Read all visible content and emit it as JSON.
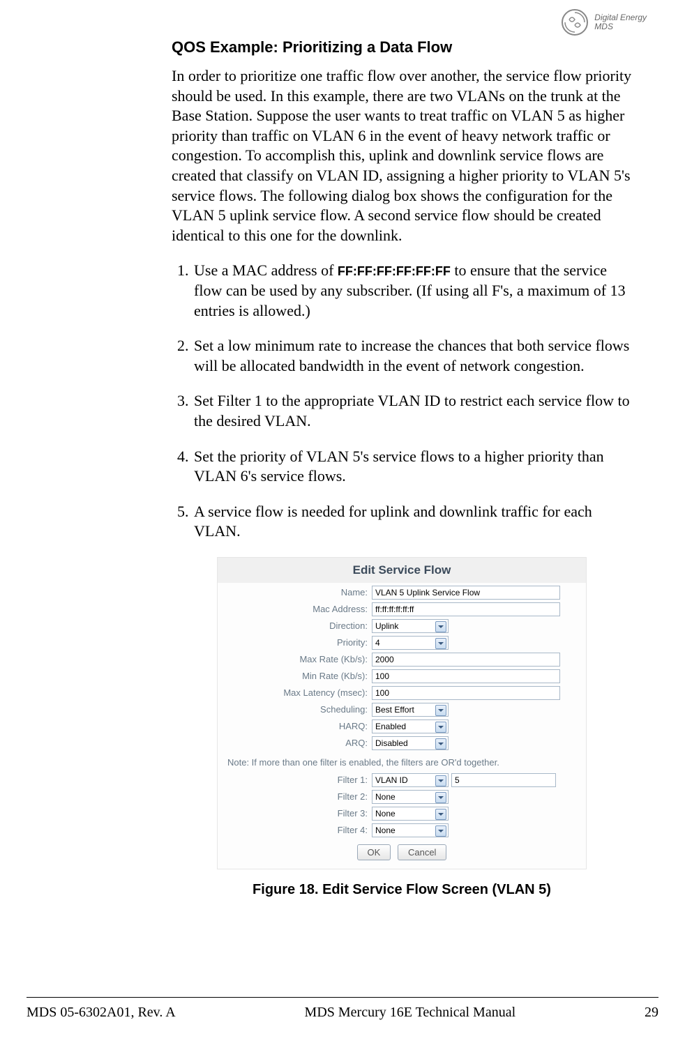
{
  "header": {
    "brand_line1": "Digital Energy",
    "brand_line2": "MDS"
  },
  "section": {
    "title": "QOS Example: Prioritizing a Data Flow",
    "intro": "In order to prioritize one traffic flow over another, the service flow priority should be used. In this example, there are two VLANs on the trunk at the Base Station. Suppose the user wants to treat traffic on VLAN 5 as higher priority than traffic on VLAN 6 in the event of heavy network traffic or congestion. To accomplish this, uplink and downlink service flows are created that classify on VLAN ID, assigning a higher priority to VLAN 5's service flows. The following dialog box shows the configuration for the VLAN 5 uplink service flow. A second service flow should be created identical to this one for the downlink.",
    "steps": [
      {
        "pre": "Use a MAC address of ",
        "code": "FF:FF:FF:FF:FF:FF",
        "post": " to ensure that the service flow can be used by any subscriber. (If using all F's, a maximum of 13 entries is allowed.)"
      },
      {
        "text": "Set a low minimum rate to increase the chances that both service flows will be allocated bandwidth in the event of network conges­tion."
      },
      {
        "text": "Set Filter 1 to the appropriate VLAN ID to restrict each service flow to the desired VLAN."
      },
      {
        "text": "Set the priority of VLAN 5's service flows to a higher priority than VLAN 6's service flows."
      },
      {
        "text": "A service flow is needed for uplink and downlink traffic for each VLAN."
      }
    ]
  },
  "dialog": {
    "title": "Edit Service Flow",
    "labels": {
      "name": "Name:",
      "mac": "Mac Address:",
      "direction": "Direction:",
      "priority": "Priority:",
      "maxrate": "Max Rate (Kb/s):",
      "minrate": "Min Rate (Kb/s):",
      "maxlatency": "Max Latency (msec):",
      "scheduling": "Scheduling:",
      "harq": "HARQ:",
      "arq": "ARQ:",
      "filter1": "Filter 1:",
      "filter2": "Filter 2:",
      "filter3": "Filter 3:",
      "filter4": "Filter 4:"
    },
    "values": {
      "name": "VLAN 5 Uplink Service Flow",
      "mac": "ff:ff:ff:ff:ff:ff",
      "direction": "Uplink",
      "priority": "4",
      "maxrate": "2000",
      "minrate": "100",
      "maxlatency": "100",
      "scheduling": "Best Effort",
      "harq": "Enabled",
      "arq": "Disabled",
      "filter1": "VLAN ID",
      "filter1_value": "5",
      "filter2": "None",
      "filter3": "None",
      "filter4": "None"
    },
    "note": "Note: If more than one filter is enabled, the filters are OR'd together.",
    "buttons": {
      "ok": "OK",
      "cancel": "Cancel"
    }
  },
  "figure_caption": "Figure 18. Edit Service Flow Screen (VLAN 5)",
  "footer": {
    "left": "MDS 05-6302A01, Rev.  A",
    "center": "MDS Mercury 16E Technical Manual",
    "right": "29"
  }
}
